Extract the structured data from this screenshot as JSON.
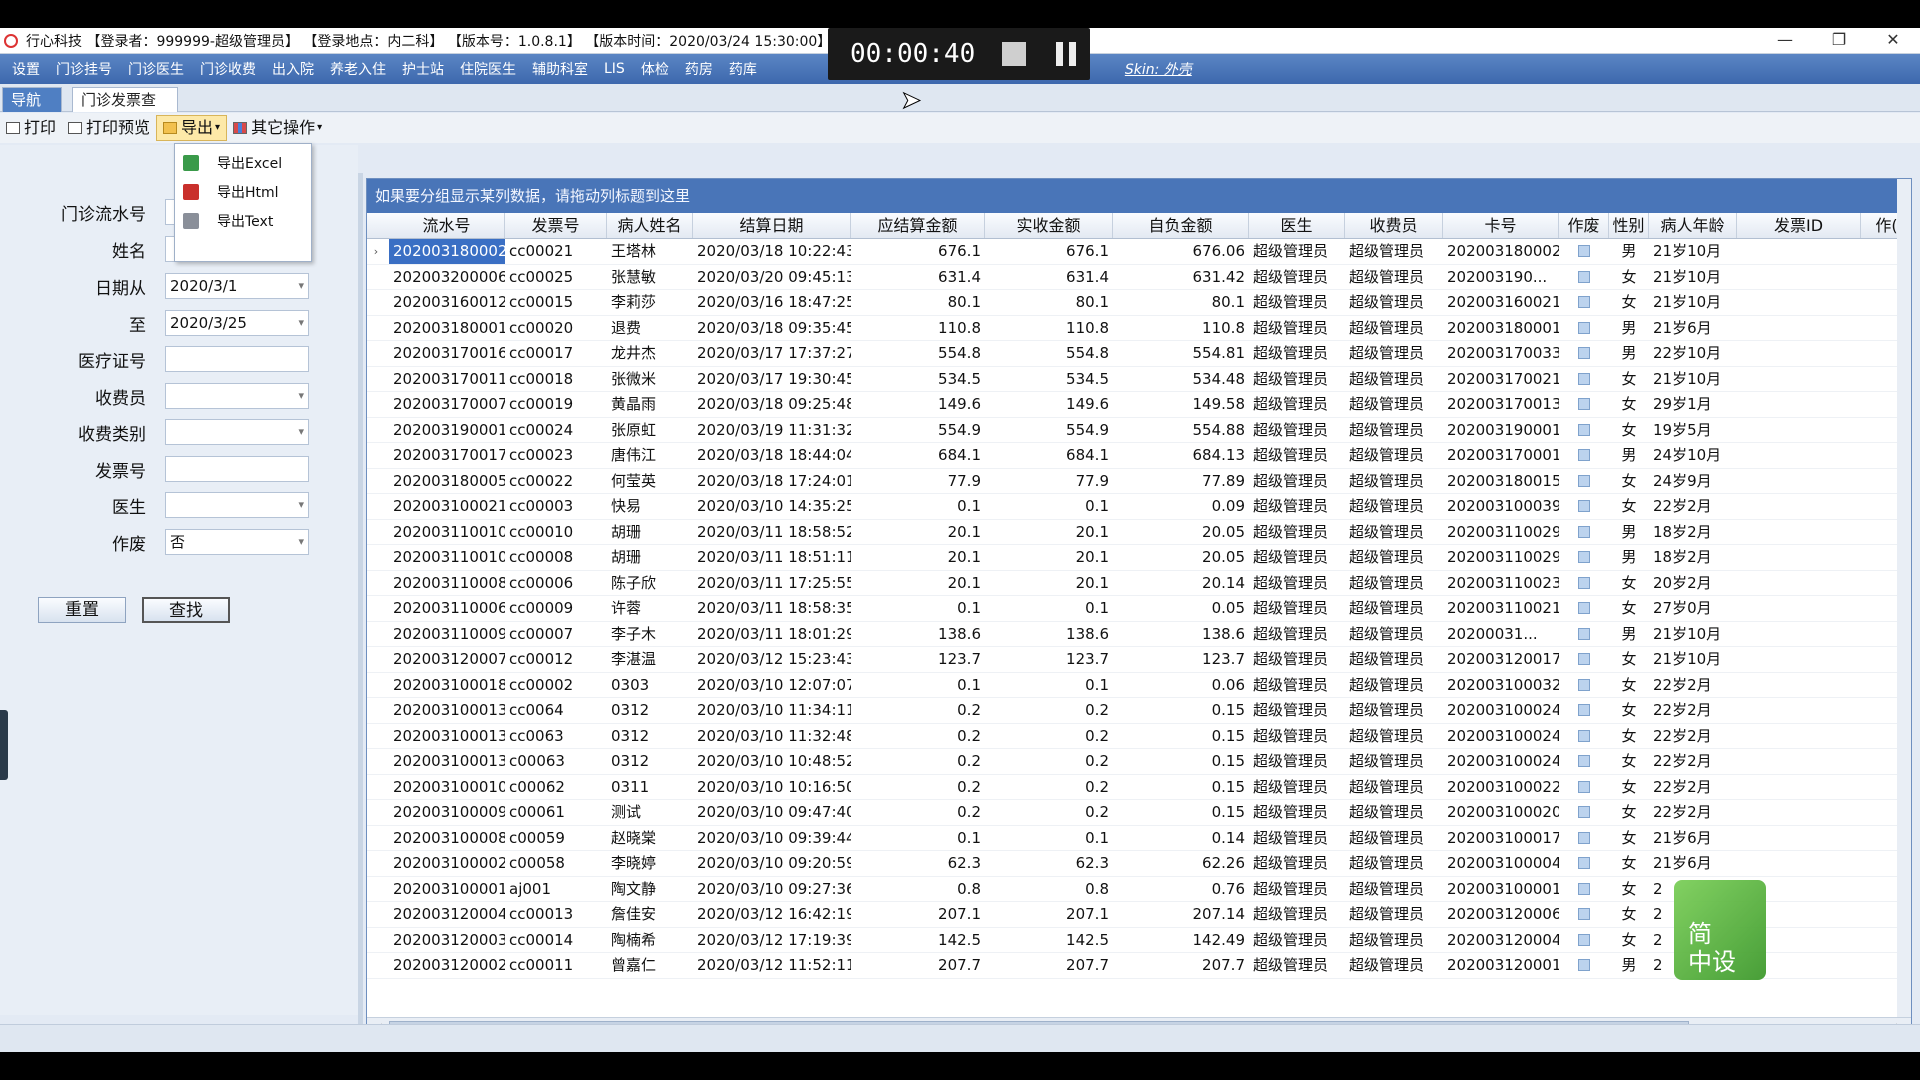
{
  "window": {
    "title": "行心科技 【登录者：999999-超级管理员】 【登录地点：内二科】 【版本号：1.0.8.1】 【版本时间：2020/03/24 15:30:00】 【服务...】                         27:8093】"
  },
  "media": {
    "time": "00:00:40"
  },
  "menu": {
    "items": [
      "设置",
      "门诊挂号",
      "门诊医生",
      "门诊收费",
      "出入院",
      "养老入住",
      "护士站",
      "住院医生",
      "辅助科室",
      "LIS",
      "体检",
      "药房",
      "药库"
    ],
    "skin": "Skin: 外壳"
  },
  "tabs": {
    "nav": "导航栏",
    "current": "门诊发票查询"
  },
  "toolbar": {
    "print": "打印",
    "preview": "打印预览",
    "export": "导出",
    "other": "其它操作"
  },
  "export_menu": {
    "excel": "导出Excel",
    "html": "导出Html",
    "text": "导出Text"
  },
  "form": {
    "serial_label": "门诊流水号",
    "name_label": "姓名",
    "date_from_label": "日期从",
    "date_from": "2020/3/1",
    "date_to_label": "至",
    "date_to": "2020/3/25",
    "medcard_label": "医疗证号",
    "cashier_label": "收费员",
    "feetype_label": "收费类别",
    "invoice_label": "发票号",
    "doctor_label": "医生",
    "void_label": "作废",
    "void_value": "否",
    "reset": "重置",
    "search": "查找"
  },
  "grid": {
    "group_hint": "如果要分组显示某列数据，请拖动列标题到这里",
    "columns": [
      "流水号",
      "发票号",
      "病人姓名",
      "结算日期",
      "应结算金额",
      "实收金额",
      "自负金额",
      "医生",
      "收费员",
      "卡号",
      "作废",
      "性别",
      "病人年龄",
      "发票ID",
      "作("
    ],
    "rows": [
      [
        "202003180002",
        "cc00021",
        "王塔林",
        "2020/03/18 10:22:43",
        "676.1",
        "676.1",
        "676.06",
        "超级管理员",
        "超级管理员",
        "202003180002",
        "男",
        "21岁10月"
      ],
      [
        "202003200006",
        "cc00025",
        "张慧敏",
        "2020/03/20 09:45:13",
        "631.4",
        "631.4",
        "631.42",
        "超级管理员",
        "超级管理员",
        "202003190...",
        "女",
        "21岁10月"
      ],
      [
        "202003160012",
        "cc00015",
        "李莉莎",
        "2020/03/16 18:47:25",
        "80.1",
        "80.1",
        "80.1",
        "超级管理员",
        "超级管理员",
        "202003160021",
        "女",
        "21岁10月"
      ],
      [
        "202003180001",
        "cc00020",
        "退费",
        "2020/03/18 09:35:45",
        "110.8",
        "110.8",
        "110.8",
        "超级管理员",
        "超级管理员",
        "202003180001",
        "男",
        "21岁6月"
      ],
      [
        "202003170016",
        "cc00017",
        "龙井杰",
        "2020/03/17 17:37:27",
        "554.8",
        "554.8",
        "554.81",
        "超级管理员",
        "超级管理员",
        "202003170033",
        "男",
        "22岁10月"
      ],
      [
        "202003170011",
        "cc00018",
        "张微米",
        "2020/03/17 19:30:45",
        "534.5",
        "534.5",
        "534.48",
        "超级管理员",
        "超级管理员",
        "202003170021",
        "女",
        "21岁10月"
      ],
      [
        "202003170007",
        "cc00019",
        "黄晶雨",
        "2020/03/18 09:25:48",
        "149.6",
        "149.6",
        "149.58",
        "超级管理员",
        "超级管理员",
        "202003170013",
        "女",
        "29岁1月"
      ],
      [
        "202003190001",
        "cc00024",
        "张原虹",
        "2020/03/19 11:31:32",
        "554.9",
        "554.9",
        "554.88",
        "超级管理员",
        "超级管理员",
        "202003190001",
        "女",
        "19岁5月"
      ],
      [
        "202003170017",
        "cc00023",
        "唐伟江",
        "2020/03/18 18:44:04",
        "684.1",
        "684.1",
        "684.13",
        "超级管理员",
        "超级管理员",
        "202003170001",
        "男",
        "24岁10月"
      ],
      [
        "202003180005",
        "cc00022",
        "何莹英",
        "2020/03/18 17:24:01",
        "77.9",
        "77.9",
        "77.89",
        "超级管理员",
        "超级管理员",
        "202003180015",
        "女",
        "24岁9月"
      ],
      [
        "202003100021",
        "cc00003",
        "快易",
        "2020/03/10 14:35:25",
        "0.1",
        "0.1",
        "0.09",
        "超级管理员",
        "超级管理员",
        "202003100039",
        "女",
        "22岁2月"
      ],
      [
        "202003110010",
        "cc00010",
        "胡珊",
        "2020/03/11 18:58:52",
        "20.1",
        "20.1",
        "20.05",
        "超级管理员",
        "超级管理员",
        "202003110029",
        "男",
        "18岁2月"
      ],
      [
        "202003110010",
        "cc00008",
        "胡珊",
        "2020/03/11 18:51:11",
        "20.1",
        "20.1",
        "20.05",
        "超级管理员",
        "超级管理员",
        "202003110029",
        "男",
        "18岁2月"
      ],
      [
        "202003110008",
        "cc00006",
        "陈子欣",
        "2020/03/11 17:25:55",
        "20.1",
        "20.1",
        "20.14",
        "超级管理员",
        "超级管理员",
        "202003110023",
        "女",
        "20岁2月"
      ],
      [
        "202003110006",
        "cc00009",
        "许蓉",
        "2020/03/11 18:58:35",
        "0.1",
        "0.1",
        "0.05",
        "超级管理员",
        "超级管理员",
        "202003110021",
        "女",
        "27岁0月"
      ],
      [
        "202003110009",
        "cc00007",
        "李子木",
        "2020/03/11 18:01:29",
        "138.6",
        "138.6",
        "138.6",
        "超级管理员",
        "超级管理员",
        "20200031...",
        "男",
        "21岁10月"
      ],
      [
        "202003120007",
        "cc00012",
        "李湛温",
        "2020/03/12 15:23:43",
        "123.7",
        "123.7",
        "123.7",
        "超级管理员",
        "超级管理员",
        "202003120017",
        "女",
        "21岁10月"
      ],
      [
        "202003100018",
        "cc00002",
        "0303",
        "2020/03/10 12:07:07",
        "0.1",
        "0.1",
        "0.06",
        "超级管理员",
        "超级管理员",
        "202003100032",
        "女",
        "22岁2月"
      ],
      [
        "202003100013",
        "cc0064",
        "0312",
        "2020/03/10 11:34:11",
        "0.2",
        "0.2",
        "0.15",
        "超级管理员",
        "超级管理员",
        "202003100024",
        "女",
        "22岁2月"
      ],
      [
        "202003100013",
        "cc0063",
        "0312",
        "2020/03/10 11:32:48",
        "0.2",
        "0.2",
        "0.15",
        "超级管理员",
        "超级管理员",
        "202003100024",
        "女",
        "22岁2月"
      ],
      [
        "202003100013",
        "c00063",
        "0312",
        "2020/03/10 10:48:52",
        "0.2",
        "0.2",
        "0.15",
        "超级管理员",
        "超级管理员",
        "202003100024",
        "女",
        "22岁2月"
      ],
      [
        "202003100010",
        "c00062",
        "0311",
        "2020/03/10 10:16:50",
        "0.2",
        "0.2",
        "0.15",
        "超级管理员",
        "超级管理员",
        "202003100022",
        "女",
        "22岁2月"
      ],
      [
        "202003100009",
        "c00061",
        "测试",
        "2020/03/10 09:47:40",
        "0.2",
        "0.2",
        "0.15",
        "超级管理员",
        "超级管理员",
        "202003100020",
        "女",
        "22岁2月"
      ],
      [
        "202003100008",
        "c00059",
        "赵晓棠",
        "2020/03/10 09:39:44",
        "0.1",
        "0.1",
        "0.14",
        "超级管理员",
        "超级管理员",
        "202003100017",
        "女",
        "21岁6月"
      ],
      [
        "202003100002",
        "c00058",
        "李晓婷",
        "2020/03/10 09:20:59",
        "62.3",
        "62.3",
        "62.26",
        "超级管理员",
        "超级管理员",
        "202003100004",
        "女",
        "21岁6月"
      ],
      [
        "202003100001",
        "aj001",
        "陶文静",
        "2020/03/10 09:27:36",
        "0.8",
        "0.8",
        "0.76",
        "超级管理员",
        "超级管理员",
        "202003100001",
        "女",
        "2"
      ],
      [
        "202003120004",
        "cc00013",
        "詹佳安",
        "2020/03/12 16:42:19",
        "207.1",
        "207.1",
        "207.14",
        "超级管理员",
        "超级管理员",
        "202003120006",
        "女",
        "2"
      ],
      [
        "202003120003",
        "cc00014",
        "陶楠希",
        "2020/03/12 17:19:39",
        "142.5",
        "142.5",
        "142.49",
        "超级管理员",
        "超级管理员",
        "202003120004",
        "女",
        "2"
      ],
      [
        "202003120002",
        "cc00011",
        "曾嘉仁",
        "2020/03/12 11:52:11",
        "207.7",
        "207.7",
        "207.7",
        "超级管理员",
        "超级管理员",
        "202003120001",
        "男",
        "2"
      ]
    ]
  },
  "watermark": {
    "line1": "简",
    "line2": "中设"
  },
  "colors": {
    "menu": "#3d68ad",
    "group_bar": "#4975b8",
    "selection": "#3a6fc4"
  }
}
